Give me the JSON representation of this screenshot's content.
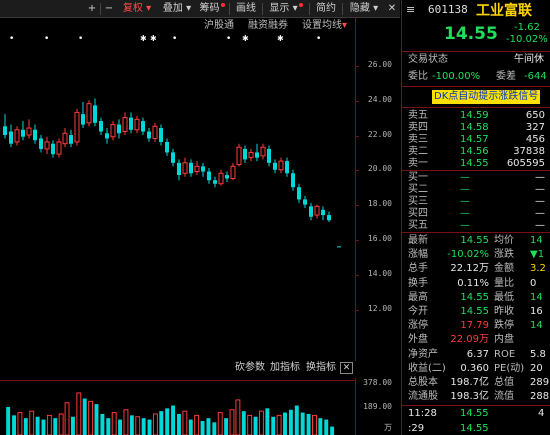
{
  "toolbar": {
    "items": [
      "+",
      "−",
      "复权",
      "叠加",
      "筹码",
      "画线",
      "显示",
      "简约",
      "隐藏"
    ],
    "close_label": "✕",
    "menu_label": "≡"
  },
  "indicator_bar": {
    "items": [
      "沪股通",
      "融资融券",
      "设置均线"
    ]
  },
  "markers": {
    "dot_labels": "•",
    "star_labels": "✱"
  },
  "price_axis": {
    "ticks": [
      "26.00",
      "24.00",
      "22.00",
      "20.00",
      "18.00",
      "16.00",
      "14.00",
      "12.00"
    ]
  },
  "mid_bar": {
    "items": [
      "砍参数",
      "加指标",
      "换指标"
    ]
  },
  "volume_axis": {
    "ticks": [
      "378.00",
      "189.00",
      "万"
    ]
  },
  "colors": {
    "up": "#ff3c3c",
    "down": "#00d8d8",
    "accent": "#ffd400",
    "border": "#7a1010"
  },
  "stock": {
    "code": "601138",
    "name": "工业富联",
    "price": "14.55",
    "change": "-1.62",
    "change_pct": "-10.02%",
    "trade_status_label": "交易状态",
    "trade_status_value": "午间休",
    "weibi_label": "委比",
    "weibi_value": "-100.00%",
    "weicha_label": "委差",
    "weicha_value": "-644",
    "dk_banner": "DK点自动提示涨跌信号"
  },
  "sell_levels": [
    {
      "label": "卖五",
      "price": "14.59",
      "vol": "650"
    },
    {
      "label": "卖四",
      "price": "14.58",
      "vol": "327"
    },
    {
      "label": "卖三",
      "price": "14.57",
      "vol": "456"
    },
    {
      "label": "卖二",
      "price": "14.56",
      "vol": "37838"
    },
    {
      "label": "卖一",
      "price": "14.55",
      "vol": "605595"
    }
  ],
  "buy_levels": [
    {
      "label": "买一",
      "price": "—",
      "vol": "—"
    },
    {
      "label": "买二",
      "price": "—",
      "vol": "—"
    },
    {
      "label": "买三",
      "price": "—",
      "vol": "—"
    },
    {
      "label": "买四",
      "price": "—",
      "vol": "—"
    },
    {
      "label": "买五",
      "price": "—",
      "vol": "—"
    }
  ],
  "stats": [
    {
      "l1": "最新",
      "v1": "14.55",
      "c1": "green",
      "l2": "均价",
      "v2": "14",
      "c2": "green"
    },
    {
      "l1": "涨幅",
      "v1": "-10.02%",
      "c1": "green",
      "l2": "涨跌",
      "v2": "▼1",
      "c2": "green"
    },
    {
      "l1": "总手",
      "v1": "22.12万",
      "c1": "white",
      "l2": "金额",
      "v2": "3.2",
      "c2": "yellow"
    },
    {
      "l1": "换手",
      "v1": "0.11%",
      "c1": "white",
      "l2": "量比",
      "v2": "0",
      "c2": "white"
    },
    {
      "l1": "最高",
      "v1": "14.55",
      "c1": "green",
      "l2": "最低",
      "v2": "14",
      "c2": "green"
    },
    {
      "l1": "今开",
      "v1": "14.55",
      "c1": "green",
      "l2": "昨收",
      "v2": "16",
      "c2": "white"
    },
    {
      "l1": "涨停",
      "v1": "17.79",
      "c1": "red",
      "l2": "跌停",
      "v2": "14",
      "c2": "green"
    },
    {
      "l1": "外盘",
      "v1": "22.09万",
      "c1": "red",
      "l2": "内盘",
      "v2": "",
      "c2": "green"
    },
    {
      "l1": "净资产",
      "v1": "6.37",
      "c1": "white",
      "l2": "ROE",
      "v2": "5.8",
      "c2": "white"
    },
    {
      "l1": "收益(二)",
      "v1": "0.360",
      "c1": "white",
      "l2": "PE(动)",
      "v2": "20",
      "c2": "white"
    },
    {
      "l1": "总股本",
      "v1": "198.7亿",
      "c1": "white",
      "l2": "总值",
      "v2": "289",
      "c2": "white"
    },
    {
      "l1": "流通股",
      "v1": "198.3亿",
      "c1": "white",
      "l2": "流值",
      "v2": "288",
      "c2": "white"
    }
  ],
  "ticks_list": [
    {
      "time": "11:28",
      "price": "14.55",
      "vol": "4"
    },
    {
      "time": ":29",
      "price": "14.55",
      "vol": ""
    }
  ],
  "candles": [
    {
      "o": 21.5,
      "c": 21.0,
      "h": 22.2,
      "l": 20.8
    },
    {
      "o": 21.2,
      "c": 20.5,
      "h": 21.6,
      "l": 20.3
    },
    {
      "o": 20.6,
      "c": 21.3,
      "h": 21.5,
      "l": 20.4
    },
    {
      "o": 21.3,
      "c": 20.9,
      "h": 21.8,
      "l": 20.7
    },
    {
      "o": 21.0,
      "c": 21.4,
      "h": 21.9,
      "l": 20.8
    },
    {
      "o": 21.3,
      "c": 20.7,
      "h": 21.6,
      "l": 20.5
    },
    {
      "o": 20.8,
      "c": 20.2,
      "h": 21.0,
      "l": 20.0
    },
    {
      "o": 20.2,
      "c": 20.6,
      "h": 20.9,
      "l": 19.9
    },
    {
      "o": 20.5,
      "c": 19.9,
      "h": 20.7,
      "l": 19.7
    },
    {
      "o": 19.9,
      "c": 20.6,
      "h": 20.8,
      "l": 19.7
    },
    {
      "o": 20.5,
      "c": 21.1,
      "h": 21.4,
      "l": 20.3
    },
    {
      "o": 21.0,
      "c": 20.5,
      "h": 21.3,
      "l": 20.3
    },
    {
      "o": 20.6,
      "c": 22.3,
      "h": 22.5,
      "l": 20.4
    },
    {
      "o": 22.2,
      "c": 21.6,
      "h": 22.9,
      "l": 21.4
    },
    {
      "o": 21.7,
      "c": 22.8,
      "h": 23.0,
      "l": 21.5
    },
    {
      "o": 22.7,
      "c": 21.7,
      "h": 23.1,
      "l": 21.5
    },
    {
      "o": 21.8,
      "c": 21.2,
      "h": 22.0,
      "l": 21.0
    },
    {
      "o": 21.1,
      "c": 20.8,
      "h": 21.4,
      "l": 20.5
    },
    {
      "o": 20.9,
      "c": 21.6,
      "h": 21.8,
      "l": 20.7
    },
    {
      "o": 21.6,
      "c": 21.1,
      "h": 21.9,
      "l": 20.8
    },
    {
      "o": 21.2,
      "c": 22.0,
      "h": 22.3,
      "l": 21.0
    },
    {
      "o": 22.0,
      "c": 21.3,
      "h": 22.3,
      "l": 21.1
    },
    {
      "o": 21.3,
      "c": 21.9,
      "h": 22.1,
      "l": 21.1
    },
    {
      "o": 21.8,
      "c": 21.2,
      "h": 22.0,
      "l": 21.0
    },
    {
      "o": 21.2,
      "c": 20.8,
      "h": 21.4,
      "l": 20.6
    },
    {
      "o": 20.8,
      "c": 21.5,
      "h": 21.7,
      "l": 20.6
    },
    {
      "o": 21.4,
      "c": 20.6,
      "h": 21.6,
      "l": 20.4
    },
    {
      "o": 20.6,
      "c": 20.0,
      "h": 20.8,
      "l": 19.8
    },
    {
      "o": 20.0,
      "c": 19.4,
      "h": 20.2,
      "l": 19.2
    },
    {
      "o": 19.4,
      "c": 18.7,
      "h": 19.6,
      "l": 18.4
    },
    {
      "o": 18.8,
      "c": 19.4,
      "h": 19.7,
      "l": 18.6
    },
    {
      "o": 19.4,
      "c": 18.8,
      "h": 19.6,
      "l": 18.6
    },
    {
      "o": 18.9,
      "c": 19.2,
      "h": 19.5,
      "l": 18.7
    },
    {
      "o": 19.2,
      "c": 18.9,
      "h": 19.4,
      "l": 18.6
    },
    {
      "o": 18.9,
      "c": 18.4,
      "h": 19.1,
      "l": 18.2
    },
    {
      "o": 18.4,
      "c": 18.2,
      "h": 18.6,
      "l": 18.0
    },
    {
      "o": 18.2,
      "c": 18.8,
      "h": 19.0,
      "l": 18.1
    },
    {
      "o": 18.7,
      "c": 18.5,
      "h": 18.9,
      "l": 18.3
    },
    {
      "o": 18.5,
      "c": 19.2,
      "h": 19.4,
      "l": 18.4
    },
    {
      "o": 19.3,
      "c": 20.3,
      "h": 20.5,
      "l": 19.2
    },
    {
      "o": 20.2,
      "c": 19.6,
      "h": 20.4,
      "l": 19.4
    },
    {
      "o": 19.7,
      "c": 20.0,
      "h": 20.2,
      "l": 19.5
    },
    {
      "o": 20.0,
      "c": 19.7,
      "h": 20.5,
      "l": 19.5
    },
    {
      "o": 19.8,
      "c": 20.3,
      "h": 20.5,
      "l": 19.6
    },
    {
      "o": 20.2,
      "c": 19.4,
      "h": 20.4,
      "l": 19.2
    },
    {
      "o": 19.4,
      "c": 19.0,
      "h": 19.6,
      "l": 18.8
    },
    {
      "o": 19.0,
      "c": 19.5,
      "h": 19.7,
      "l": 18.8
    },
    {
      "o": 19.5,
      "c": 18.8,
      "h": 19.7,
      "l": 18.6
    },
    {
      "o": 18.8,
      "c": 18.0,
      "h": 19.0,
      "l": 17.8
    },
    {
      "o": 18.0,
      "c": 17.3,
      "h": 18.2,
      "l": 17.1
    },
    {
      "o": 17.3,
      "c": 17.0,
      "h": 17.5,
      "l": 16.8
    },
    {
      "o": 16.9,
      "c": 16.3,
      "h": 17.1,
      "l": 16.1
    },
    {
      "o": 16.4,
      "c": 16.9,
      "h": 17.0,
      "l": 16.2
    },
    {
      "o": 16.7,
      "c": 16.4,
      "h": 16.9,
      "l": 16.1
    },
    {
      "o": 16.4,
      "c": 16.1,
      "h": 16.6,
      "l": 16.0
    },
    {
      "o": 14.6,
      "c": 14.55,
      "h": 14.6,
      "l": 14.55
    }
  ],
  "volumes": [
    {
      "v": 200,
      "up": false
    },
    {
      "v": 140,
      "up": false
    },
    {
      "v": 160,
      "up": true
    },
    {
      "v": 120,
      "up": false
    },
    {
      "v": 170,
      "up": true
    },
    {
      "v": 130,
      "up": false
    },
    {
      "v": 110,
      "up": false
    },
    {
      "v": 140,
      "up": true
    },
    {
      "v": 120,
      "up": false
    },
    {
      "v": 150,
      "up": true
    },
    {
      "v": 230,
      "up": true
    },
    {
      "v": 130,
      "up": false
    },
    {
      "v": 300,
      "up": true
    },
    {
      "v": 260,
      "up": false
    },
    {
      "v": 240,
      "up": true
    },
    {
      "v": 220,
      "up": false
    },
    {
      "v": 150,
      "up": false
    },
    {
      "v": 120,
      "up": false
    },
    {
      "v": 160,
      "up": true
    },
    {
      "v": 110,
      "up": false
    },
    {
      "v": 180,
      "up": true
    },
    {
      "v": 140,
      "up": false
    },
    {
      "v": 130,
      "up": true
    },
    {
      "v": 120,
      "up": false
    },
    {
      "v": 110,
      "up": false
    },
    {
      "v": 150,
      "up": true
    },
    {
      "v": 170,
      "up": false
    },
    {
      "v": 190,
      "up": false
    },
    {
      "v": 210,
      "up": false
    },
    {
      "v": 150,
      "up": false
    },
    {
      "v": 170,
      "up": true
    },
    {
      "v": 110,
      "up": false
    },
    {
      "v": 140,
      "up": true
    },
    {
      "v": 100,
      "up": false
    },
    {
      "v": 120,
      "up": false
    },
    {
      "v": 90,
      "up": false
    },
    {
      "v": 160,
      "up": true
    },
    {
      "v": 120,
      "up": false
    },
    {
      "v": 180,
      "up": true
    },
    {
      "v": 250,
      "up": true
    },
    {
      "v": 170,
      "up": false
    },
    {
      "v": 140,
      "up": true
    },
    {
      "v": 130,
      "up": false
    },
    {
      "v": 170,
      "up": true
    },
    {
      "v": 190,
      "up": false
    },
    {
      "v": 130,
      "up": false
    },
    {
      "v": 140,
      "up": true
    },
    {
      "v": 160,
      "up": false
    },
    {
      "v": 180,
      "up": false
    },
    {
      "v": 210,
      "up": false
    },
    {
      "v": 160,
      "up": false
    },
    {
      "v": 150,
      "up": false
    },
    {
      "v": 140,
      "up": true
    },
    {
      "v": 120,
      "up": false
    },
    {
      "v": 110,
      "up": false
    },
    {
      "v": 60,
      "up": false
    }
  ]
}
